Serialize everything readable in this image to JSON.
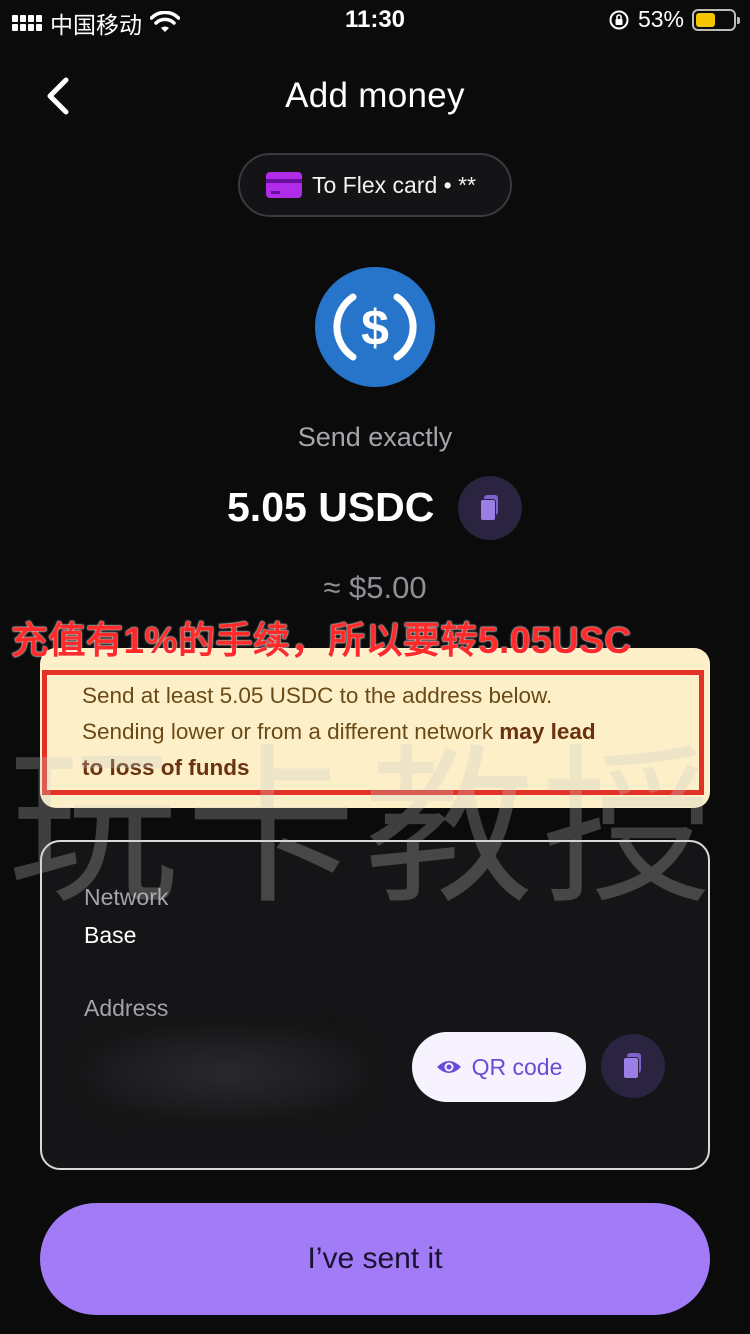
{
  "status_bar": {
    "carrier": "中国移动",
    "time": "11:30",
    "battery_percent": "53%",
    "battery_level": 0.53
  },
  "header": {
    "title": "Add money"
  },
  "destination": {
    "label": "To Flex card • **"
  },
  "send": {
    "label": "Send exactly",
    "amount": "5.05 USDC",
    "approx": "≈ $5.00"
  },
  "annotation": {
    "text": "充值有1%的手续，所以要转5.05USC"
  },
  "warning": {
    "line1": "Send at least 5.05 USDC to the address below.",
    "line2_normal": "Sending lower or from a different network ",
    "line2_bold": "may lead",
    "line3_bold": "to loss of funds"
  },
  "watermark": {
    "text": "玩卡教授"
  },
  "network_panel": {
    "network_label": "Network",
    "network_value": "Base",
    "address_label": "Address",
    "qr_button_label": "QR code"
  },
  "primary_button": {
    "label": "I’ve sent it"
  },
  "colors": {
    "accent": "#a27bf6",
    "warning_bg": "#fdf0c8",
    "annotation_red": "#ff2a2a",
    "coin_blue": "#2775ca"
  }
}
